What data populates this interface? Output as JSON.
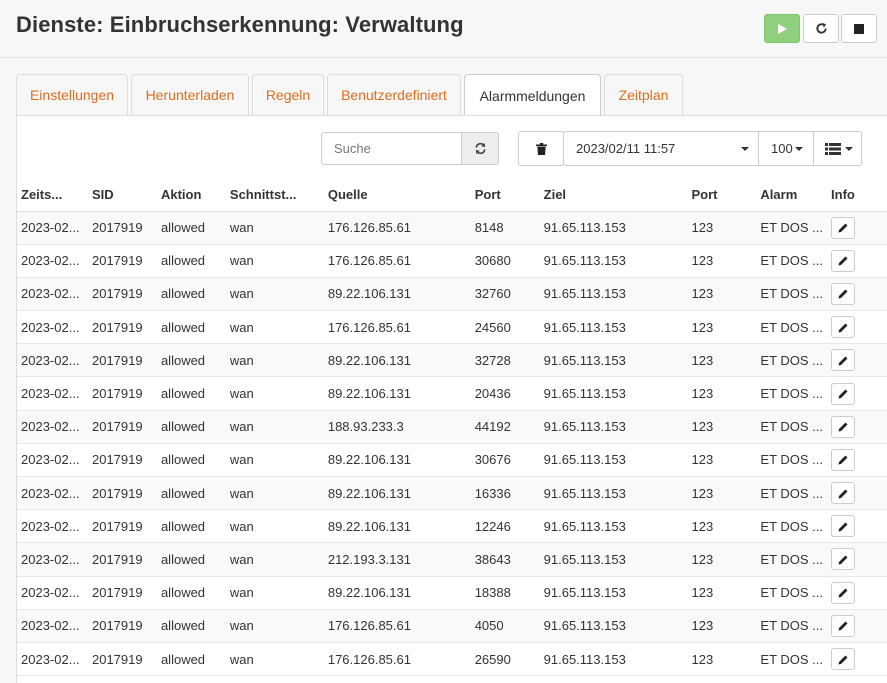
{
  "page": {
    "title": "Dienste: Einbruchserkennung: Verwaltung"
  },
  "tabs": [
    {
      "label": "Einstellungen",
      "active": false
    },
    {
      "label": "Herunterladen",
      "active": false
    },
    {
      "label": "Regeln",
      "active": false
    },
    {
      "label": "Benutzerdefiniert",
      "active": false
    },
    {
      "label": "Alarmmeldungen",
      "active": true
    },
    {
      "label": "Zeitplan",
      "active": false
    }
  ],
  "toolbar": {
    "search_placeholder": "Suche",
    "date_value": "2023/02/11 11:57",
    "rows_per_page": "100"
  },
  "table": {
    "columns": [
      "Zeits...",
      "SID",
      "Aktion",
      "Schnittst...",
      "Quelle",
      "Port",
      "Ziel",
      "Port",
      "Alarm",
      "Info"
    ],
    "rows": [
      [
        "2023-02...",
        "2017919",
        "allowed",
        "wan",
        "176.126.85.61",
        "8148",
        "91.65.113.153",
        "123",
        "ET DOS ..."
      ],
      [
        "2023-02...",
        "2017919",
        "allowed",
        "wan",
        "176.126.85.61",
        "30680",
        "91.65.113.153",
        "123",
        "ET DOS ..."
      ],
      [
        "2023-02...",
        "2017919",
        "allowed",
        "wan",
        "89.22.106.131",
        "32760",
        "91.65.113.153",
        "123",
        "ET DOS ..."
      ],
      [
        "2023-02...",
        "2017919",
        "allowed",
        "wan",
        "176.126.85.61",
        "24560",
        "91.65.113.153",
        "123",
        "ET DOS ..."
      ],
      [
        "2023-02...",
        "2017919",
        "allowed",
        "wan",
        "89.22.106.131",
        "32728",
        "91.65.113.153",
        "123",
        "ET DOS ..."
      ],
      [
        "2023-02...",
        "2017919",
        "allowed",
        "wan",
        "89.22.106.131",
        "20436",
        "91.65.113.153",
        "123",
        "ET DOS ..."
      ],
      [
        "2023-02...",
        "2017919",
        "allowed",
        "wan",
        "188.93.233.3",
        "44192",
        "91.65.113.153",
        "123",
        "ET DOS ..."
      ],
      [
        "2023-02...",
        "2017919",
        "allowed",
        "wan",
        "89.22.106.131",
        "30676",
        "91.65.113.153",
        "123",
        "ET DOS ..."
      ],
      [
        "2023-02...",
        "2017919",
        "allowed",
        "wan",
        "89.22.106.131",
        "16336",
        "91.65.113.153",
        "123",
        "ET DOS ..."
      ],
      [
        "2023-02...",
        "2017919",
        "allowed",
        "wan",
        "89.22.106.131",
        "12246",
        "91.65.113.153",
        "123",
        "ET DOS ..."
      ],
      [
        "2023-02...",
        "2017919",
        "allowed",
        "wan",
        "212.193.3.131",
        "38643",
        "91.65.113.153",
        "123",
        "ET DOS ..."
      ],
      [
        "2023-02...",
        "2017919",
        "allowed",
        "wan",
        "89.22.106.131",
        "18388",
        "91.65.113.153",
        "123",
        "ET DOS ..."
      ],
      [
        "2023-02...",
        "2017919",
        "allowed",
        "wan",
        "176.126.85.61",
        "4050",
        "91.65.113.153",
        "123",
        "ET DOS ..."
      ],
      [
        "2023-02...",
        "2017919",
        "allowed",
        "wan",
        "176.126.85.61",
        "26590",
        "91.65.113.153",
        "123",
        "ET DOS ..."
      ]
    ]
  },
  "icons": {
    "play": "play-icon",
    "reload": "reload-icon",
    "stop": "stop-icon",
    "refresh": "refresh-icon",
    "trash": "trash-icon",
    "columns": "list-icon",
    "info": "pencil-icon"
  },
  "colors": {
    "accent": "#e06c1f",
    "play_button": "#8fd07e"
  }
}
